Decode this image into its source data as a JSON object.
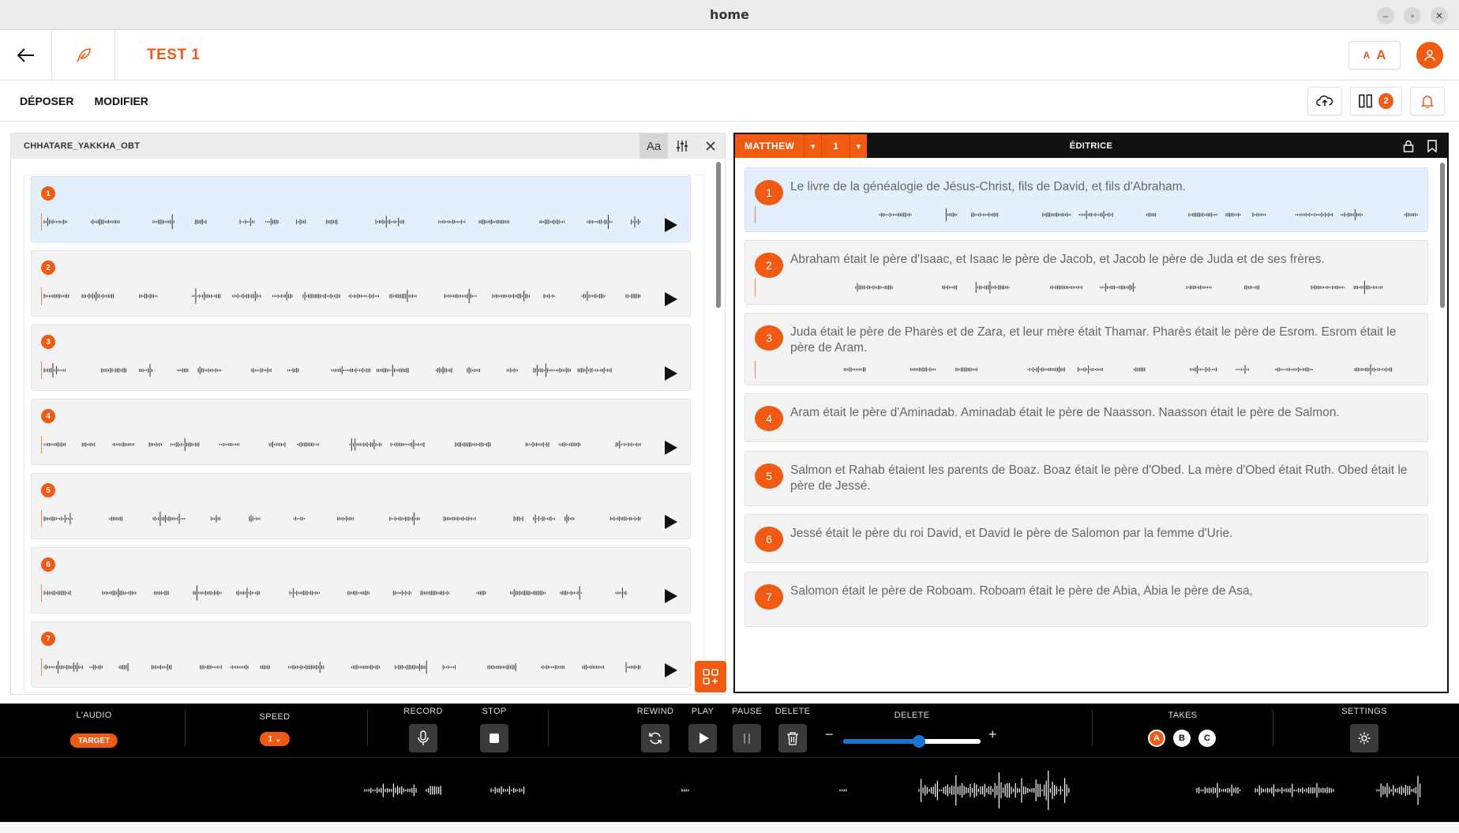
{
  "window": {
    "title": "home"
  },
  "topbar": {
    "project_title": "TEST 1",
    "font_small": "A",
    "font_big": "A"
  },
  "menu": {
    "items": [
      "DÉPOSER",
      "MODIFIER"
    ],
    "notifications_count": "2"
  },
  "source_panel": {
    "title": "CHHATARE_YAKKHA_OBT",
    "font_tool_label": "Aa",
    "verses": [
      "1",
      "2",
      "3",
      "4",
      "5",
      "6",
      "7"
    ]
  },
  "target_panel": {
    "book": "MATTHEW",
    "chapter": "1",
    "title": "ÉDITRICE",
    "verses": [
      {
        "num": "1",
        "text": "Le livre de la généalogie de Jésus-Christ, fils de David, et fils d'Abraham."
      },
      {
        "num": "2",
        "text": "Abraham était le père d'Isaac, et Isaac le père de Jacob, et Jacob le père de Juda et de ses frères."
      },
      {
        "num": "3",
        "text": "Juda était le père de Pharès et de Zara, et leur mère était Thamar. Pharès était le père de Esrom. Esrom était le père de Aram."
      },
      {
        "num": "4",
        "text": "Aram était le père d'Aminadab. Aminadab était le père de Naasson. Naasson était le père de Salmon."
      },
      {
        "num": "5",
        "text": "Salmon et Rahab étaient les parents de Boaz. Boaz était le père d'Obed. La mère d'Obed était Ruth. Obed était le père de Jessé."
      },
      {
        "num": "6",
        "text": "Jessé était le père du roi David, et David le père de Salomon par la femme d'Urie."
      },
      {
        "num": "7",
        "text": "Salomon était le père de Roboam. Roboam était le père de Abia, Abia le père de Asa,"
      }
    ]
  },
  "transport": {
    "audio_label": "L'AUDIO",
    "audio_value": "TARGET",
    "speed_label": "SPEED",
    "speed_value": "1",
    "record_label": "RECORD",
    "stop_label": "STOP",
    "rewind_label": "REWIND",
    "play_label": "PLAY",
    "pause_label": "PAUSE",
    "delete_label": "DELETE",
    "volume_label": "DELETE",
    "volume_level": 0.55,
    "takes_label": "TAKES",
    "takes": [
      "A",
      "B",
      "C"
    ],
    "active_take": "A",
    "settings_label": "SETTINGS"
  },
  "colors": {
    "accent": "#f05a12",
    "slider": "#1976d2",
    "selected_card": "#e3f0fc"
  }
}
